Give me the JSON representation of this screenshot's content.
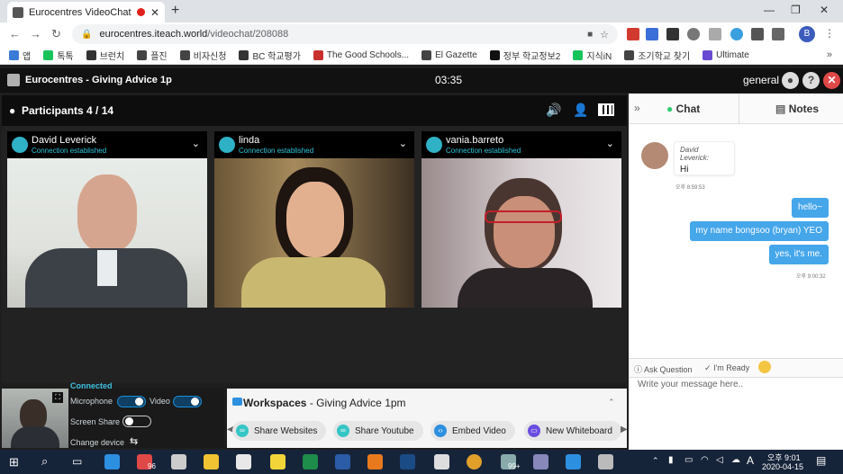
{
  "browser": {
    "tab_title": "Eurocentres VideoChat",
    "url_host": "eurocentres.iteach.world",
    "url_path": "/videochat/208088",
    "profile_letter": "B",
    "bookmarks": [
      {
        "label": "앱",
        "color": "#3b7bd8"
      },
      {
        "label": "톡톡",
        "color": "#19c35b"
      },
      {
        "label": "브런치",
        "color": "#333333"
      },
      {
        "label": "플진",
        "color": "#444444"
      },
      {
        "label": "비자신청",
        "color": "#444444"
      },
      {
        "label": "BC 학교평가",
        "color": "#333333"
      },
      {
        "label": "The Good Schools...",
        "color": "#c9302c"
      },
      {
        "label": "El Gazette",
        "color": "#444444"
      },
      {
        "label": "정부 학교정보2",
        "color": "#111111"
      },
      {
        "label": "지식iN",
        "color": "#19c35b"
      },
      {
        "label": "조기학교 찾기",
        "color": "#444444"
      },
      {
        "label": "Ultimate",
        "color": "#6a4bd0"
      }
    ]
  },
  "app": {
    "brand": "Eurocentres - Giving Advice 1p",
    "timer": "03:35",
    "user": "general"
  },
  "participants": {
    "title": "Participants 4 / 14",
    "tiles": [
      {
        "name": "David Leverick",
        "status": "Connection established"
      },
      {
        "name": "linda",
        "status": "Connection established"
      },
      {
        "name": "vania.barreto",
        "status": "Connection established"
      }
    ]
  },
  "controls": {
    "connected": "Connected",
    "microphone": "Microphone",
    "video": "Video",
    "screen_share": "Screen Share",
    "change_device": "Change device"
  },
  "workspaces": {
    "title": "Workspaces",
    "subtitle": "Giving Advice 1pm",
    "buttons": [
      {
        "label": "Share Websites",
        "color": "#36c5c5"
      },
      {
        "label": "Share Youtube",
        "color": "#36c5c5"
      },
      {
        "label": "Embed Video",
        "color": "#2d8fe0"
      },
      {
        "label": "New Whiteboard",
        "color": "#6b4de0"
      }
    ]
  },
  "chat": {
    "tab_chat": "Chat",
    "tab_notes": "Notes",
    "incoming": {
      "author": "David Leverick:",
      "text": "Hi",
      "time": "오후 8:59:53"
    },
    "outgoing": [
      {
        "text": "hello~"
      },
      {
        "text": "my name bongsoo (bryan) YEO"
      },
      {
        "text": "yes, it's me."
      }
    ],
    "outgoing_time": "오후 9:00:32",
    "ask_question": "Ask Question",
    "im_ready": "I'm Ready",
    "placeholder": "Write your message here.."
  },
  "taskbar": {
    "time": "오후 9:01",
    "date": "2020-04-15",
    "badge1": "96",
    "badge2": "99+",
    "ime": "A"
  }
}
